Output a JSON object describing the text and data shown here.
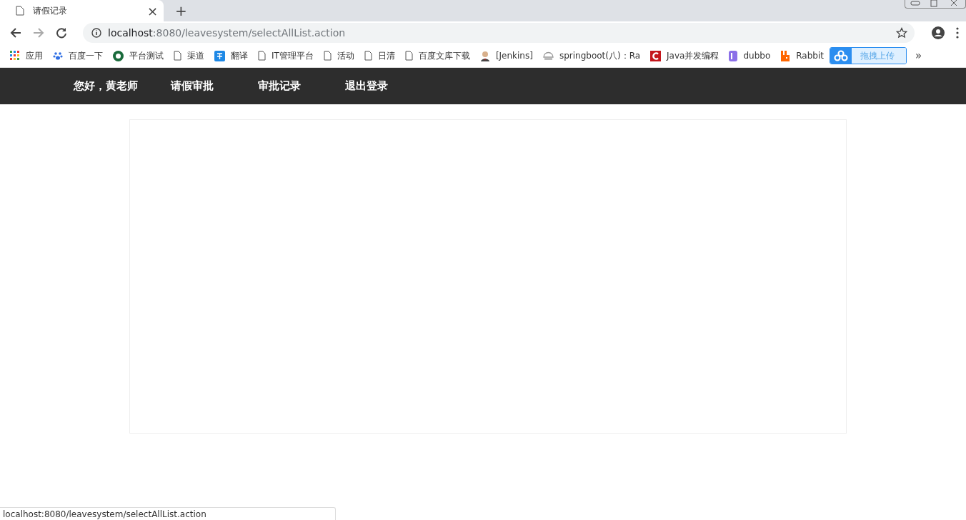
{
  "browser": {
    "tab": {
      "title": "请假记录",
      "close": "×"
    },
    "new_tab": "+",
    "address": {
      "host": "localhost",
      "path": ":8080/leavesystem/selectAllList.action"
    },
    "bookmarks": [
      {
        "kind": "apps",
        "label": "应用"
      },
      {
        "kind": "paw",
        "label": "百度一下"
      },
      {
        "kind": "round",
        "label": "平台测试"
      },
      {
        "kind": "page",
        "label": "渠道"
      },
      {
        "kind": "translate",
        "label": "翻译"
      },
      {
        "kind": "page",
        "label": "IT管理平台"
      },
      {
        "kind": "page",
        "label": "活动"
      },
      {
        "kind": "page",
        "label": "日清"
      },
      {
        "kind": "page",
        "label": "百度文库下载"
      },
      {
        "kind": "person",
        "label": "[Jenkins]"
      },
      {
        "kind": "helmet",
        "label": "springboot(八)：Ra"
      },
      {
        "kind": "c",
        "label": "Java并发编程"
      },
      {
        "kind": "d",
        "label": "dubbo"
      },
      {
        "kind": "rabbit",
        "label": "Rabbit"
      }
    ],
    "upload_button": "拖拽上传",
    "more": "»",
    "status_url": "localhost:8080/leavesystem/selectAllList.action"
  },
  "nav": {
    "greeting": "您好，黄老师",
    "links": [
      "请假审批",
      "审批记录",
      "退出登录"
    ]
  }
}
